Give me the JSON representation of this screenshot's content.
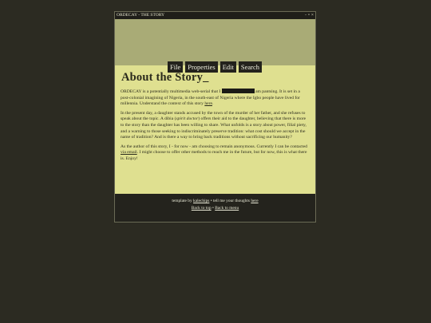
{
  "window": {
    "title": "ORDECAY - THE STORY",
    "controls": [
      "-",
      "▫",
      "×"
    ]
  },
  "menu": [
    "File",
    "Properties",
    "Edit",
    "Search"
  ],
  "page": {
    "title": "About the Story_",
    "p1": {
      "a": "ORDECAY is a potentially multimedia web-serial that I ",
      "b": " am pantsing. It is set in a post-colonial imagining of Nigeria, in the south-east of Nigeria where the Igbo people have lived for millennia. Understand the context of this story ",
      "link": "here",
      "c": "."
    },
    "p2": {
      "a": "In the present day, a daughter stands accused by the town of the murder of her father, and she refuses to speak about the topic. A dibia (",
      "em": "spirit doctor",
      "b": ") offers their aid to the daughter, believing that there is more to the story than the daughter has been willing to share. What unfolds is a story about power, filial piety, and a warning to those seeking to indiscriminately preserve tradition: what cost should we accept in the name of tradition? And is there a way to bring back traditions without sacrificing our humanity?"
    },
    "p3": {
      "a": "As the author of this story, I - for now - am choosing to remain anonymous. Currently I can be contacted ",
      "link": "via email",
      "b": ". I might choose to offer other methods to reach me in the future, but for now, this is what there is. Enjoy!"
    }
  },
  "footer": {
    "line1_a": "template by ",
    "line1_link1": "kalechips",
    "line1_b": " • tell me your thoughts ",
    "line1_link2": "here",
    "line2_link1": "Back to top",
    "line2_sep": " • ",
    "line2_link2": "Back to menu"
  }
}
